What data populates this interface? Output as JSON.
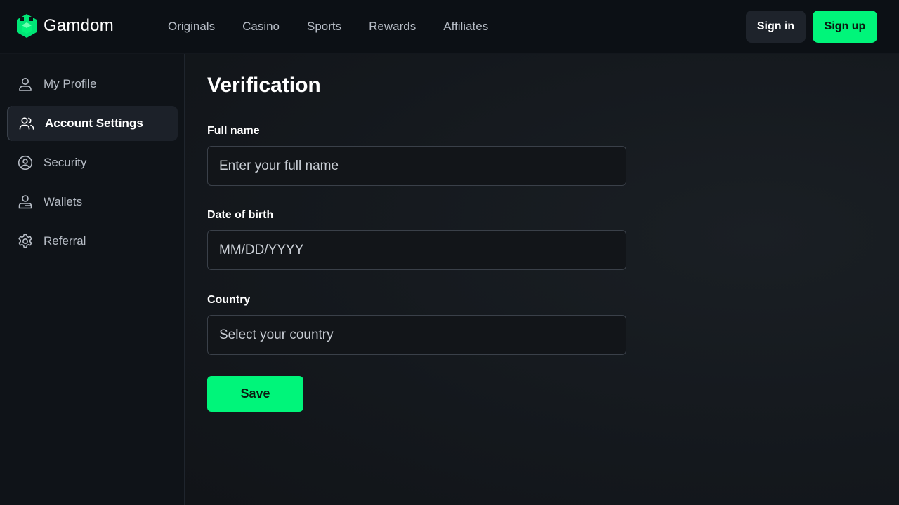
{
  "header": {
    "brand": "Gamdom",
    "nav": [
      "Originals",
      "Casino",
      "Sports",
      "Rewards",
      "Affiliates"
    ],
    "signin_label": "Sign in",
    "signup_label": "Sign up"
  },
  "sidebar": {
    "items": [
      {
        "label": "My Profile",
        "icon": "user-icon",
        "active": false
      },
      {
        "label": "Account Settings",
        "icon": "users-icon",
        "active": true
      },
      {
        "label": "Security",
        "icon": "user-circle-icon",
        "active": false
      },
      {
        "label": "Wallets",
        "icon": "wallet-icon",
        "active": false
      },
      {
        "label": "Referral",
        "icon": "gear-icon",
        "active": false
      }
    ]
  },
  "main": {
    "title": "Verification",
    "fields": [
      {
        "label": "Full name",
        "placeholder": "Enter your full name",
        "value": ""
      },
      {
        "label": "Date of birth",
        "placeholder": "MM/DD/YYYY",
        "value": ""
      },
      {
        "label": "Country",
        "placeholder": "Select your country",
        "value": ""
      }
    ],
    "save_label": "Save"
  },
  "colors": {
    "accent": "#00f57a",
    "background": "#13171d",
    "topbar": "#0c1015",
    "sidebar": "#0f1318"
  }
}
